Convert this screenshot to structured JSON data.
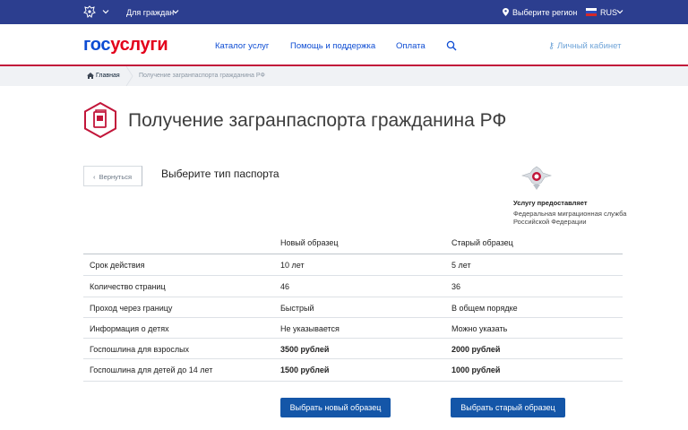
{
  "topbar": {
    "citizens_label": "Для граждан",
    "region_label": "Выберите регион",
    "lang_label": "RUS"
  },
  "header": {
    "logo_part1": "гос",
    "logo_part2": "услуги",
    "nav": [
      "Каталог услуг",
      "Помощь и поддержка",
      "Оплата"
    ],
    "cabinet_label": "Личный кабинет"
  },
  "breadcrumbs": {
    "home": "Главная",
    "current": "Получение загранпаспорта гражданина РФ"
  },
  "page_title": "Получение загранпаспорта гражданина РФ",
  "back_label": "Вернуться",
  "section_title": "Выберите тип паспорта",
  "provider": {
    "label": "Услугу предоставляет",
    "name": "Федеральная миграционная служба Российской Федерации"
  },
  "table": {
    "headers": [
      "",
      "Новый образец",
      "Старый образец"
    ],
    "rows": [
      [
        "Срок действия",
        "10 лет",
        "5 лет"
      ],
      [
        "Количество страниц",
        "46",
        "36"
      ],
      [
        "Проход через границу",
        "Быстрый",
        "В общем порядке"
      ],
      [
        "Информация о детях",
        "Не указывается",
        "Можно указать"
      ],
      [
        "Госпошлина для взрослых",
        "3500 рублей",
        "2000 рублей"
      ],
      [
        "Госпошлина для детей до 14 лет",
        "1500 рублей",
        "1000 рублей"
      ]
    ]
  },
  "buttons": {
    "new": "Выбрать новый образец",
    "old": "Выбрать старый образец"
  },
  "colors": {
    "topbar": "#2c3e8f",
    "brand_blue": "#0d4cd3",
    "brand_red": "#e3001b",
    "button": "#1456a8",
    "accent_line": "#c2163a"
  },
  "icons": [
    "emblem-icon",
    "chevron-down-icon",
    "location-pin-icon",
    "flag-icon",
    "search-icon",
    "key-icon",
    "home-icon",
    "passport-icon",
    "chevron-left-icon",
    "fms-emblem-icon"
  ]
}
